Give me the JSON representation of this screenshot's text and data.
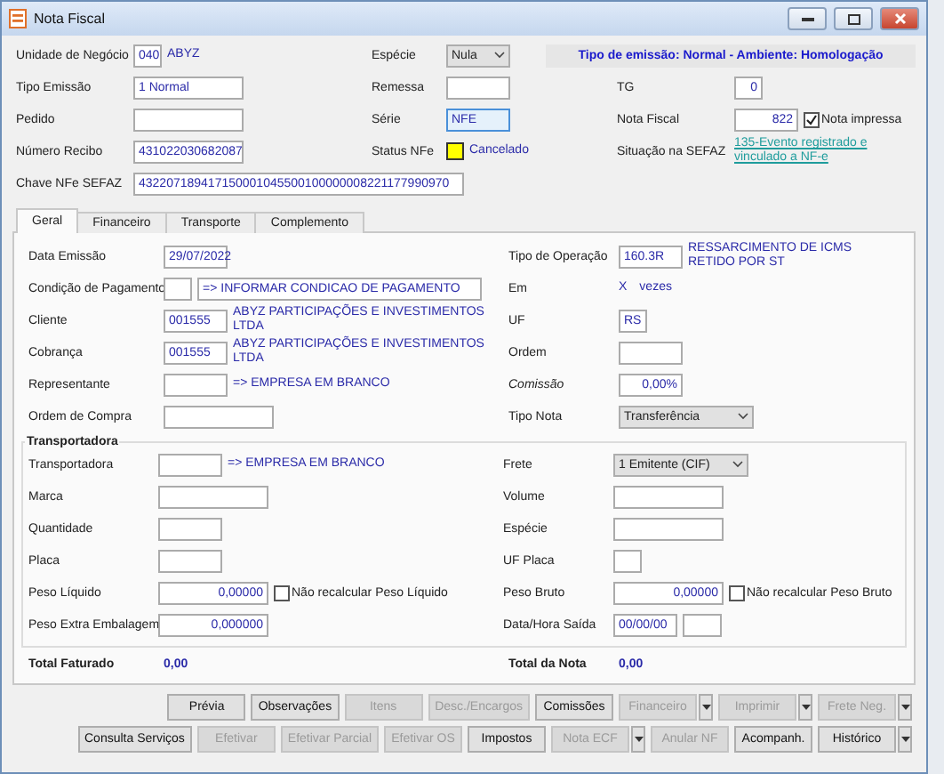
{
  "window": {
    "title": "Nota Fiscal"
  },
  "header": {
    "rows": [
      {
        "cells": [
          {
            "label": "Unidade de Negócio",
            "controls": [
              {
                "kind": "tiny",
                "value": "040"
              },
              {
                "kind": "text",
                "value": "ABYZ"
              }
            ]
          },
          {
            "label": "Espécie",
            "controls": [
              {
                "kind": "picker",
                "value": "Nula"
              }
            ]
          },
          {
            "controls": [
              {
                "kind": "banner",
                "value": "Tipo de emissão: Normal - Ambiente: Homologação"
              }
            ]
          }
        ]
      },
      {
        "cells": [
          {
            "label": "Tipo Emissão",
            "controls": [
              {
                "kind": "medium",
                "value": "1 Normal"
              }
            ]
          },
          {
            "label": "Remessa",
            "controls": [
              {
                "kind": "short"
              }
            ]
          },
          {
            "label": "TG",
            "controls": [
              {
                "kind": "tiny",
                "value": "0",
                "numeric": true
              }
            ]
          }
        ]
      },
      {
        "cells": [
          {
            "label": "Pedido",
            "controls": [
              {
                "kind": "medium"
              }
            ]
          },
          {
            "label": "Série",
            "controls": [
              {
                "kind": "short",
                "value": "NFE",
                "focused": true
              }
            ]
          },
          {
            "label": "Nota Fiscal",
            "controls": [
              {
                "kind": "short",
                "value": "822",
                "numeric": true
              },
              {
                "kind": "check",
                "label": "Nota impressa",
                "checked": true
              }
            ]
          }
        ]
      },
      {
        "cells": [
          {
            "label": "Número Recibo",
            "controls": [
              {
                "kind": "medium",
                "value": "431022030682087"
              }
            ]
          },
          {
            "label": "Status NFe",
            "controls": [
              {
                "kind": "swatch",
                "color": "#ffff00"
              },
              {
                "kind": "text",
                "value": "Cancelado"
              }
            ]
          },
          {
            "label": "Situação na SEFAZ",
            "controls": [
              {
                "kind": "link",
                "value": "135-Evento registrado e vinculado a NF-e"
              }
            ]
          }
        ]
      },
      {
        "cells": [
          {
            "label": "Chave NFe SEFAZ",
            "controls": [
              {
                "kind": "xlong",
                "value": "432207189417150001045500100000008221177990970"
              }
            ]
          }
        ]
      }
    ]
  },
  "tabs": [
    {
      "label": "Geral",
      "selected": true
    },
    {
      "label": "Financeiro",
      "selected": false
    },
    {
      "label": "Transporte",
      "selected": false
    },
    {
      "label": "Complemento",
      "selected": false
    }
  ],
  "general": {
    "rows": [
      {
        "cells": [
          {
            "label": "Data Emissão",
            "controls": [
              {
                "kind": "short",
                "value": "29/07/2022"
              }
            ]
          },
          {
            "label": "Tipo de Operação",
            "controls": [
              {
                "kind": "short",
                "value": "160.3R"
              },
              {
                "kind": "text",
                "value": "RESSARCIMENTO DE ICMS RETIDO POR ST"
              }
            ]
          }
        ]
      },
      {
        "cells": [
          {
            "label": "Condição de Pagamento",
            "controls": [
              {
                "kind": "tiny"
              },
              {
                "kind": "long",
                "value": "=> INFORMAR CONDICAO DE PAGAMENTO"
              }
            ]
          },
          {
            "label": "Em",
            "controls": [
              {
                "kind": "text",
                "value": "X"
              },
              {
                "kind": "text",
                "value": "vezes"
              }
            ]
          }
        ]
      },
      {
        "cells": [
          {
            "label": "Cliente",
            "controls": [
              {
                "kind": "short",
                "value": "001555"
              },
              {
                "kind": "text",
                "value": "ABYZ PARTICIPAÇÕES E INVESTIMENTOS LTDA"
              }
            ]
          },
          {
            "label": "UF",
            "controls": [
              {
                "kind": "tiny",
                "value": "RS"
              }
            ]
          }
        ]
      },
      {
        "cells": [
          {
            "label": "Cobrança",
            "controls": [
              {
                "kind": "short",
                "value": "001555"
              },
              {
                "kind": "text",
                "value": "ABYZ PARTICIPAÇÕES E INVESTIMENTOS LTDA"
              }
            ]
          },
          {
            "label": "Ordem",
            "controls": [
              {
                "kind": "short"
              }
            ]
          }
        ]
      },
      {
        "cells": [
          {
            "label": "Representante",
            "controls": [
              {
                "kind": "short"
              },
              {
                "kind": "text",
                "value": "=> EMPRESA EM BRANCO"
              }
            ]
          },
          {
            "label": "Comissão",
            "italic": true,
            "controls": [
              {
                "kind": "short",
                "value": "0,00%",
                "numeric": true
              }
            ]
          }
        ]
      },
      {
        "cells": [
          {
            "label": "Ordem de Compra",
            "controls": [
              {
                "kind": "medium"
              }
            ]
          },
          {
            "label": "Tipo Nota",
            "controls": [
              {
                "kind": "select",
                "value": "Transferência"
              }
            ]
          }
        ]
      }
    ]
  },
  "transport": {
    "title": "Transportadora",
    "rows": [
      {
        "cells": [
          {
            "label": "Transportadora",
            "controls": [
              {
                "kind": "short"
              },
              {
                "kind": "text",
                "value": "=> EMPRESA EM BRANCO"
              }
            ]
          },
          {
            "label": "Frete",
            "controls": [
              {
                "kind": "select",
                "value": "1 Emitente (CIF)"
              }
            ]
          }
        ]
      },
      {
        "cells": [
          {
            "label": "Marca",
            "controls": [
              {
                "kind": "medium"
              }
            ]
          },
          {
            "label": "Volume",
            "controls": [
              {
                "kind": "medium"
              }
            ]
          }
        ]
      },
      {
        "cells": [
          {
            "label": "Quantidade",
            "controls": [
              {
                "kind": "short"
              }
            ]
          },
          {
            "label": "Espécie",
            "controls": [
              {
                "kind": "medium"
              }
            ]
          }
        ]
      },
      {
        "cells": [
          {
            "label": "Placa",
            "controls": [
              {
                "kind": "short"
              }
            ]
          },
          {
            "label": "UF Placa",
            "controls": [
              {
                "kind": "tiny"
              }
            ]
          }
        ]
      },
      {
        "cells": [
          {
            "label": "Peso Líquido",
            "controls": [
              {
                "kind": "medium",
                "value": "0,00000",
                "numeric": true
              },
              {
                "kind": "check",
                "label": "Não recalcular Peso Líquido",
                "checked": false
              }
            ]
          },
          {
            "label": "Peso Bruto",
            "controls": [
              {
                "kind": "medium",
                "value": "0,00000",
                "numeric": true
              },
              {
                "kind": "check",
                "label": "Não recalcular Peso Bruto",
                "checked": false
              }
            ]
          }
        ]
      },
      {
        "cells": [
          {
            "label": "Peso Extra Embalagem",
            "controls": [
              {
                "kind": "medium",
                "value": "0,000000",
                "numeric": true
              }
            ]
          },
          {
            "label": "Data/Hora Saída",
            "controls": [
              {
                "kind": "short",
                "value": "00/00/00"
              },
              {
                "kind": "small"
              }
            ]
          }
        ]
      }
    ]
  },
  "totals": [
    {
      "label": "Total Faturado",
      "value": "0,00"
    },
    {
      "label": "Total da Nota",
      "value": "0,00"
    }
  ],
  "button_rows": [
    [
      {
        "label": "Prévia",
        "disabled": false,
        "dropdown": false
      },
      {
        "label": "Observações",
        "disabled": false,
        "dropdown": false
      },
      {
        "label": "Itens",
        "disabled": true,
        "dropdown": false
      },
      {
        "label": "Desc./Encargos",
        "disabled": true,
        "dropdown": false
      },
      {
        "label": "Comissões",
        "disabled": false,
        "dropdown": false
      },
      {
        "label": "Financeiro",
        "disabled": true,
        "dropdown": true
      },
      {
        "label": "Imprimir",
        "disabled": true,
        "dropdown": true
      },
      {
        "label": "Frete Neg.",
        "disabled": true,
        "dropdown": true
      }
    ],
    [
      {
        "label": "Consulta Serviços",
        "disabled": false,
        "dropdown": false
      },
      {
        "label": "Efetivar",
        "disabled": true,
        "dropdown": false
      },
      {
        "label": "Efetivar Parcial",
        "disabled": true,
        "dropdown": false
      },
      {
        "label": "Efetivar OS",
        "disabled": true,
        "dropdown": false
      },
      {
        "label": "Impostos",
        "disabled": false,
        "dropdown": false
      },
      {
        "label": "Nota ECF",
        "disabled": true,
        "dropdown": true
      },
      {
        "label": "Anular NF",
        "disabled": true,
        "dropdown": false
      },
      {
        "label": "Acompanh.",
        "disabled": false,
        "dropdown": false
      },
      {
        "label": "Histórico",
        "disabled": false,
        "dropdown": true
      }
    ]
  ]
}
